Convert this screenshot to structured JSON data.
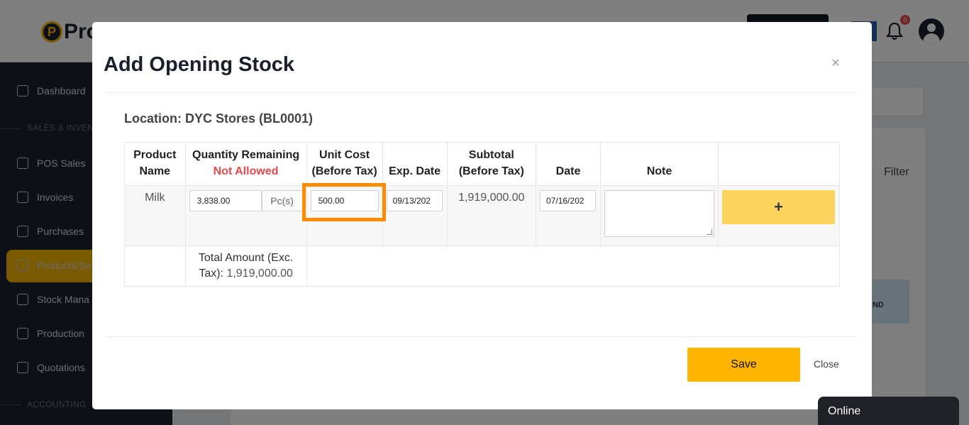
{
  "app": {
    "logo_text": "Pro",
    "notification_count": "0",
    "filter_label": "Filter",
    "background_column_fragment": "ND"
  },
  "sidebar": {
    "items": [
      {
        "label": "Dashboard",
        "icon": "home-icon"
      },
      {
        "label": "POS Sales",
        "icon": "bag-icon"
      },
      {
        "label": "Invoices",
        "icon": "invoice-icon"
      },
      {
        "label": "Purchases",
        "icon": "box-icon"
      },
      {
        "label": "Products/Se",
        "icon": "tag-icon"
      },
      {
        "label": "Stock Mana",
        "icon": "stock-icon"
      },
      {
        "label": "Production",
        "icon": "factory-icon"
      },
      {
        "label": "Quotations",
        "icon": "quote-icon"
      }
    ],
    "sections": [
      "SALES & INVENT",
      "ACCOUNTING"
    ]
  },
  "modal": {
    "title": "Add Opening Stock",
    "close_symbol": "×",
    "location": "Location: DYC Stores (BL0001)",
    "columns": {
      "product_name": "Product Name",
      "quantity_remaining": "Quantity Remaining",
      "not_allowed": "Not Allowed",
      "unit_cost": "Unit Cost (Before Tax)",
      "exp_date": "Exp. Date",
      "subtotal": "Subtotal (Before Tax)",
      "date": "Date",
      "note": "Note"
    },
    "row": {
      "product": "Milk",
      "quantity": "3,838.00",
      "unit": "Pc(s)",
      "unit_cost": "500.00",
      "exp_date": "09/13/202",
      "subtotal": "1,919,000.00",
      "date": "07/16/202",
      "note": "",
      "add_symbol": "+"
    },
    "total": {
      "label_line1": "Total Amount (Exc.",
      "label_line2": "Tax):",
      "value": "1,919,000.00"
    },
    "save_label": "Save",
    "close_label": "Close"
  },
  "chat": {
    "status": "Online"
  },
  "colors": {
    "accent": "#ffb400",
    "add_button": "#fdd35f",
    "highlight": "#ff8c00",
    "danger": "#e5484d",
    "sidebar_bg": "#1c2130"
  }
}
